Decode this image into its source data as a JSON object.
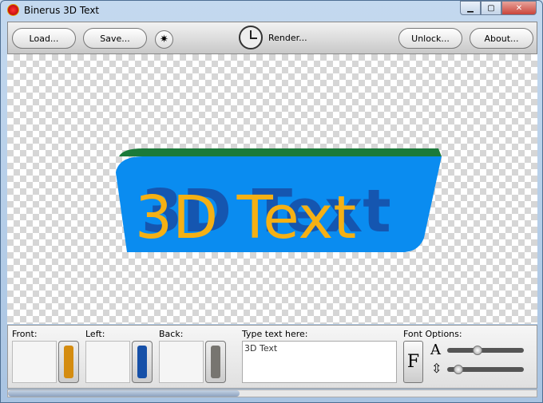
{
  "window": {
    "title": "Binerus 3D Text"
  },
  "toolbar": {
    "load": "Load...",
    "save": "Save...",
    "render": "Render...",
    "unlock": "Unlock...",
    "about": "About..."
  },
  "preview": {
    "text": "3D Text",
    "front_color": "#f5b014",
    "left_color": "#1556b0",
    "back_color": "#0a8cf0",
    "top_color": "#1b7a3a"
  },
  "panel": {
    "front_label": "Front:",
    "left_label": "Left:",
    "back_label": "Back:",
    "type_label": "Type text here:",
    "text_value": "3D Text",
    "font_options_label": "Font Options:",
    "font_button": "F",
    "size_icon": "A",
    "front_swatch": "#d48c10",
    "left_swatch": "#1650a8",
    "back_swatch": "#777570",
    "size_slider": 0.4,
    "spacing_slider": 0.1
  }
}
